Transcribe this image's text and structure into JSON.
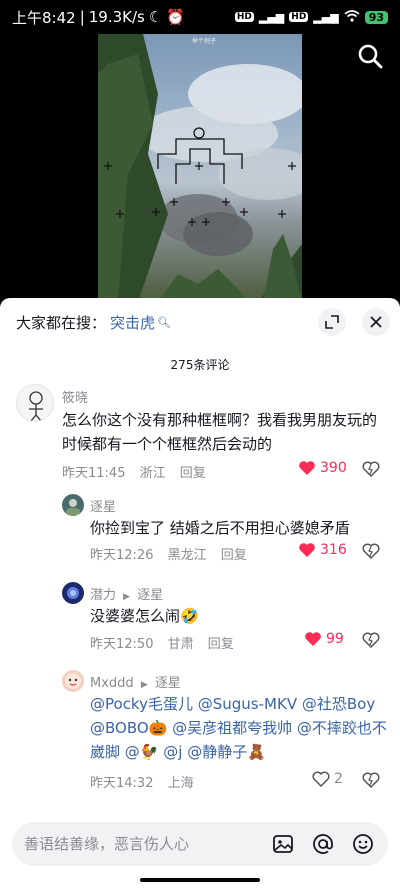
{
  "status_bar": {
    "time": "上午8:42",
    "net_speed": "19.3K/s",
    "battery": "93"
  },
  "video": {
    "overlay_caption": "举个例子"
  },
  "trending": {
    "label": "大家都在搜：",
    "term": "突击虎"
  },
  "comment_count": "275条评论",
  "comments": [
    {
      "user": "筱晓",
      "text": "怎么你这个没有那种框框啊？我看我男朋友玩的时候都有一个个框框然后会动的",
      "time": "昨天11:45",
      "location": "浙江",
      "reply": "回复",
      "likes": "390"
    },
    {
      "user": "逐星",
      "text": "你捡到宝了 结婚之后不用担心婆媳矛盾",
      "time": "昨天12:26",
      "location": "黑龙江",
      "reply": "回复",
      "likes": "316"
    },
    {
      "user": "潜力",
      "reply_to": "逐星",
      "text": "没婆婆怎么闹",
      "time": "昨天12:50",
      "location": "甘肃",
      "reply": "回复",
      "likes": "99"
    },
    {
      "user": "Mxddd",
      "reply_to": "逐星",
      "line1": [
        "@Pocky毛蛋儿",
        "@Sugus-MKV",
        "@社恐Boy"
      ],
      "line2": [
        "@BOBO🎃",
        "@吴彦祖都夸我帅",
        "@不摔跤也不"
      ],
      "line3": [
        "崴脚",
        "@🐓",
        "@j",
        "@静静子🧸"
      ],
      "time": "昨天14:32",
      "location": "上海",
      "likes": "2"
    }
  ],
  "input": {
    "placeholder": "善语结善缘，恶言伤人心"
  },
  "colors": {
    "accent_red": "#fe2c55",
    "mention_blue": "#3a64a8",
    "meta_grey": "#8a8b91"
  },
  "icons": [
    "search-icon",
    "expand-icon",
    "close-icon",
    "heart-icon",
    "dislike-heart-icon",
    "image-icon",
    "at-icon",
    "emoji-icon"
  ]
}
